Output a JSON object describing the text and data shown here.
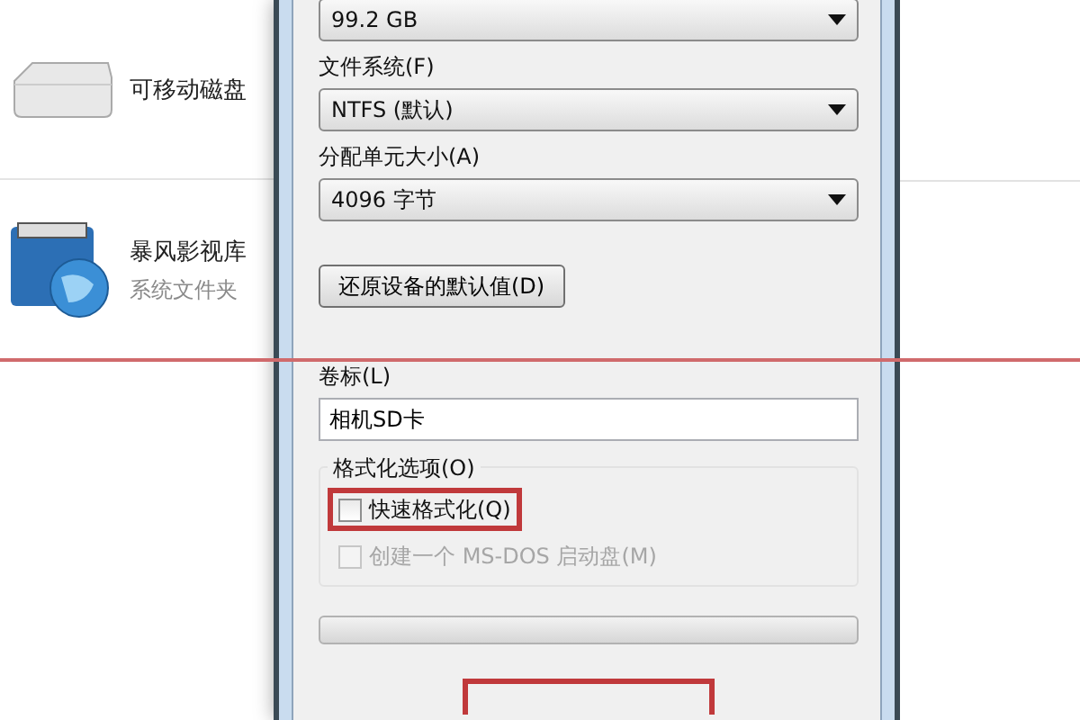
{
  "explorer": {
    "items": [
      {
        "kind": "drive",
        "name": "可移动磁盘"
      },
      {
        "kind": "library",
        "name": "暴风影视库",
        "subtitle": "系统文件夹"
      }
    ]
  },
  "dialog": {
    "capacity": {
      "value": "99.2 GB"
    },
    "file_system": {
      "label": "文件系统(F)",
      "value": "NTFS (默认)"
    },
    "allocation_unit": {
      "label": "分配单元大小(A)",
      "value": "4096 字节"
    },
    "restore_button": "还原设备的默认值(D)",
    "volume_label": {
      "label": "卷标(L)",
      "value": "相机SD卡"
    },
    "format_options": {
      "label": "格式化选项(O)",
      "options": [
        {
          "label": "快速格式化(Q)",
          "checked": false,
          "disabled": false,
          "highlighted": true
        },
        {
          "label": "创建一个 MS-DOS 启动盘(M)",
          "checked": false,
          "disabled": true,
          "highlighted": false
        }
      ]
    },
    "progress": {
      "level": 0
    },
    "start_button": {
      "highlighted": true
    }
  },
  "annotation_line": true
}
